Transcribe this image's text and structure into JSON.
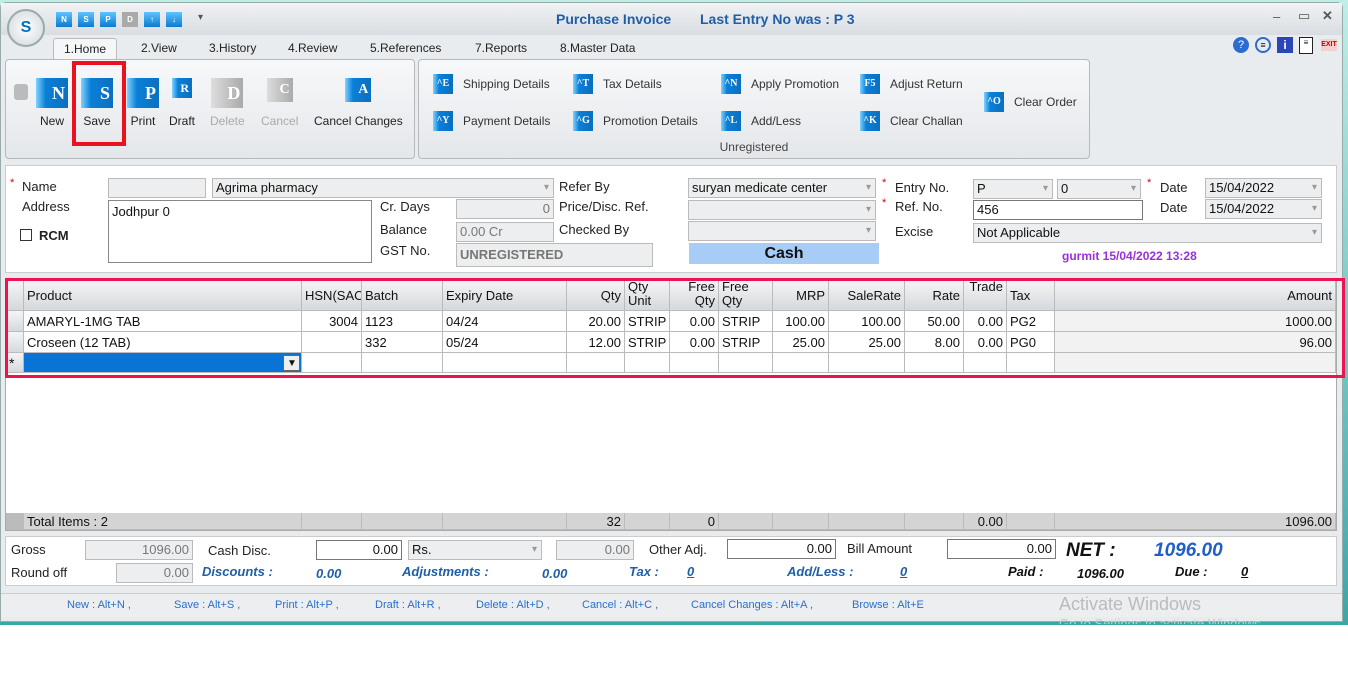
{
  "window": {
    "title": "Purchase Invoice",
    "last_entry": "Last Entry No was : P 3",
    "logo_letter": "S"
  },
  "quick_access": [
    "N",
    "S",
    "P",
    "D",
    "↑",
    "↓"
  ],
  "tabs": [
    "1.Home",
    "2.View",
    "3.History",
    "4.Review",
    "5.References",
    "7.Reports",
    "8.Master Data"
  ],
  "ribbon": {
    "home": [
      {
        "label": "New",
        "key": "N",
        "enabled": true
      },
      {
        "label": "Save",
        "key": "S",
        "enabled": true
      },
      {
        "label": "Print",
        "key": "P",
        "enabled": true
      },
      {
        "label": "Draft",
        "key": "R",
        "enabled": true
      },
      {
        "label": "Delete",
        "key": "D",
        "enabled": false
      },
      {
        "label": "Cancel",
        "key": "C",
        "enabled": false
      },
      {
        "label": "Cancel Changes",
        "key": "A",
        "enabled": true
      }
    ],
    "group2": [
      {
        "label": "Shipping Details",
        "key": "^E"
      },
      {
        "label": "Payment Details",
        "key": "^Y"
      },
      {
        "label": "Tax Details",
        "key": "^T"
      },
      {
        "label": "Promotion Details",
        "key": "^G"
      },
      {
        "label": "Apply Promotion",
        "key": "^N"
      },
      {
        "label": "Add/Less",
        "key": "^L"
      },
      {
        "label": "Adjust Return",
        "key": "F5"
      },
      {
        "label": "Clear Challan",
        "key": "^K"
      },
      {
        "label": "Clear Order",
        "key": "^O"
      }
    ],
    "group2_caption": "Unregistered"
  },
  "form": {
    "name_label": "Name",
    "name_code": "",
    "name_value": "Agrima pharmacy",
    "address_label": "Address",
    "address_value": "Jodhpur  0",
    "rcm_label": "RCM",
    "cr_days_label": "Cr. Days",
    "cr_days": "0",
    "balance_label": "Balance",
    "balance": "0.00 Cr",
    "gst_label": "GST No.",
    "gst": "UNREGISTERED",
    "refer_by_label": "Refer By",
    "refer_by": "suryan medicate center",
    "price_ref_label": "Price/Disc. Ref.",
    "price_ref": "",
    "checked_by_label": "Checked By",
    "checked_by": "",
    "payment_mode": "Cash",
    "entry_no_label": "Entry No.",
    "entry_prefix": "P",
    "entry_no": "0",
    "ref_no_label": "Ref. No.",
    "ref_no": "456",
    "date_label": "Date",
    "date1": "15/04/2022",
    "date2": "15/04/2022",
    "excise_label": "Excise",
    "excise": "Not Applicable",
    "user_stamp": "gurmit 15/04/2022 13:28"
  },
  "grid": {
    "columns": [
      "Product",
      "HSN(SAC",
      "Batch",
      "Expiry Date",
      "Qty",
      "Qty Unit",
      "Free Qty",
      "Free Qty",
      "MRP",
      "SaleRate",
      "Rate",
      "Trade",
      "Tax",
      "Amount"
    ],
    "rows": [
      [
        " AMARYL-1MG TAB",
        "3004",
        "1123",
        "04/24",
        "20.00",
        "STRIP",
        "0.00",
        "STRIP",
        "100.00",
        "100.00",
        "50.00",
        "0.00",
        "PG2",
        "1000.00"
      ],
      [
        "Croseen (12 TAB)",
        "",
        "332",
        "05/24",
        "12.00",
        "STRIP",
        "0.00",
        "STRIP",
        "25.00",
        "25.00",
        "8.00",
        "0.00",
        "PG0",
        "96.00"
      ]
    ],
    "new_row_marker": "*",
    "totals": {
      "label": "Total Items : 2",
      "qty": "32",
      "free_qty": "0",
      "trade": "0.00",
      "amount": "1096.00"
    }
  },
  "summary": {
    "gross_label": "Gross",
    "gross": "1096.00",
    "round_off_label": "Round off",
    "round_off": "0.00",
    "cash_disc_label": "Cash Disc.",
    "cash_disc": "0.00",
    "cash_disc_type": "Rs.",
    "cash_disc_amt": "0.00",
    "other_adj_label": "Other Adj.",
    "other_adj": "0.00",
    "bill_amount_label": "Bill Amount",
    "bill_amount": "0.00",
    "net_label": "NET :",
    "net": "1096.00",
    "discounts_label": "Discounts :",
    "discounts": "0.00",
    "adjustments_label": "Adjustments :",
    "adjustments": "0.00",
    "tax_label": "Tax :",
    "tax": "0",
    "addless_label": "Add/Less :",
    "addless": "0",
    "paid_label": "Paid :",
    "paid": "1096.00",
    "due_label": "Due :",
    "due": "0"
  },
  "shortcuts": [
    "New : Alt+N ,",
    "Save : Alt+S ,",
    "Print : Alt+P ,",
    "Draft : Alt+R ,",
    "Delete : Alt+D ,",
    "Cancel : Alt+C ,",
    "Cancel Changes : Alt+A ,",
    "Browse : Alt+E"
  ],
  "watermark": {
    "line1": "Activate Windows",
    "line2": "Go to Settings to activate Windows."
  }
}
